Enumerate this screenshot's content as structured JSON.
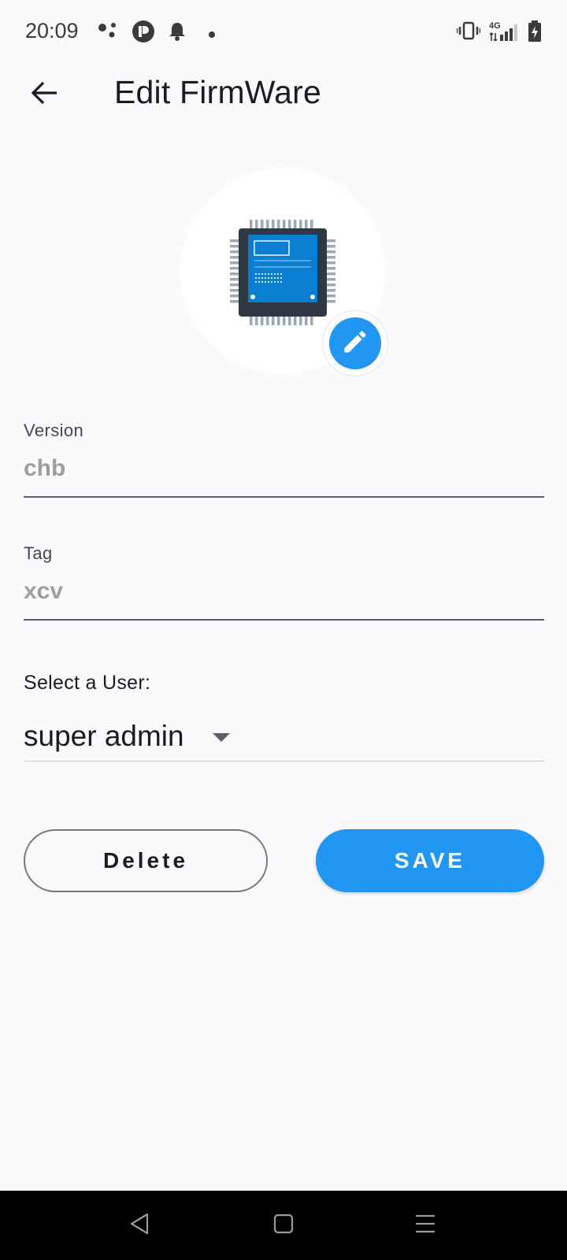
{
  "status_bar": {
    "time": "20:09",
    "network": "4G",
    "icons": [
      "assistant-dots-icon",
      "p-circle-icon",
      "bell-icon",
      "dot-icon",
      "vibrate-icon",
      "signal-icon",
      "battery-charging-icon"
    ]
  },
  "app_bar": {
    "title": "Edit FirmWare",
    "back_icon": "arrow-back-icon"
  },
  "avatar": {
    "image": "microchip-icon",
    "edit_icon": "pencil-icon"
  },
  "form": {
    "version": {
      "label": "Version",
      "value": "chb"
    },
    "tag": {
      "label": "Tag",
      "value": "xcv"
    },
    "user_select": {
      "label": "Select a User:",
      "value": "super admin"
    }
  },
  "actions": {
    "delete_label": "Delete",
    "save_label": "SAVE"
  },
  "nav_bar": {
    "icons": [
      "back-triangle-icon",
      "home-square-icon",
      "menu-lines-icon"
    ]
  },
  "colors": {
    "background": "#fcf9fd",
    "accent": "#2196f3",
    "chip_body": "#2f3944",
    "chip_screen": "#0a7ed1",
    "nav_bar": "#000000"
  }
}
